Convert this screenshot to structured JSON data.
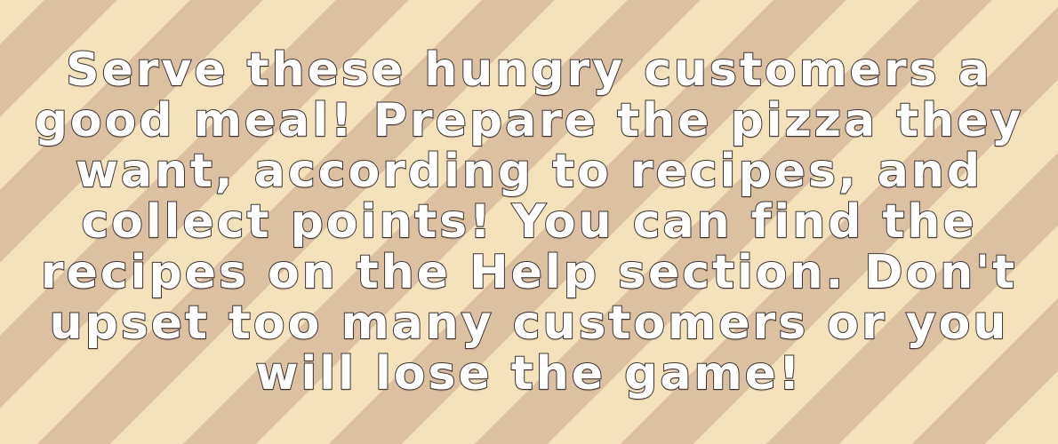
{
  "colors": {
    "stripe_light": "#f4e3ba",
    "stripe_dark": "#dcc1a0",
    "text_fill": "#ffffff",
    "text_outline": "#3a3333"
  },
  "instructions": {
    "text": "Serve these hungry customers a good meal! Prepare the pizza they want, according to recipes, and collect points! You can find the recipes on the Help section. Don't upset too many customers or you will lose the game!"
  }
}
